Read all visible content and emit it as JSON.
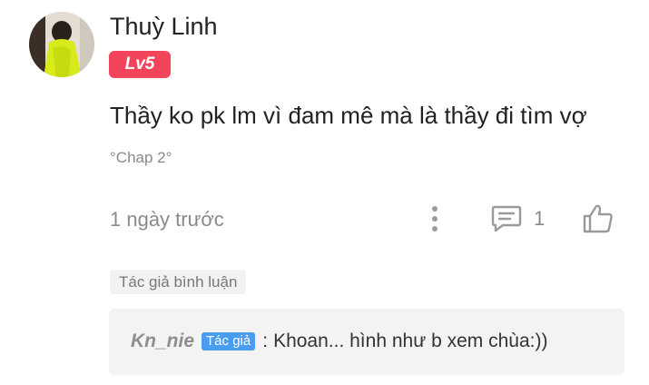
{
  "comment": {
    "username": "Thuỳ Linh",
    "level": "Lv5",
    "text": "Thầy ko pk lm vì đam mê mà là thầy đi tìm vợ",
    "chapter": "°Chap 2°",
    "timestamp": "1 ngày trước",
    "reply_count": "1"
  },
  "author_section": {
    "label": "Tác giả bình luận"
  },
  "reply": {
    "author": "Kn_nie",
    "badge": "Tác giả",
    "separator": ":",
    "text": "Khoan... hình như b xem chùa:))"
  },
  "colors": {
    "level_badge": "#f2455b",
    "author_badge": "#4a9cf0",
    "muted_text": "#8a8a8a",
    "reply_bg": "#f3f3f3"
  },
  "icons": {
    "more": "more-vertical-icon",
    "reply": "comment-bubble-icon",
    "like": "thumbs-up-icon"
  }
}
